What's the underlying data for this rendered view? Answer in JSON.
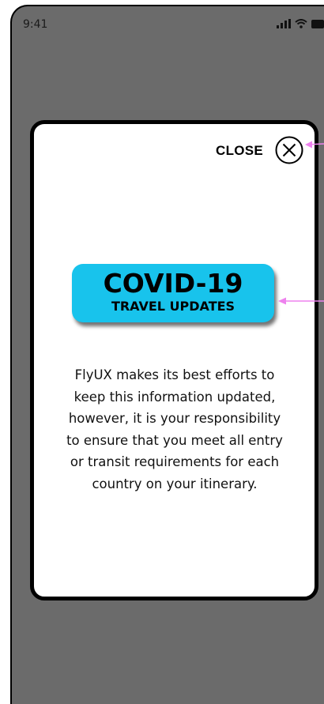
{
  "status_bar": {
    "time": "9:41",
    "signal_icon": "cellular-signal-icon",
    "wifi_icon": "wifi-icon",
    "battery_icon": "battery-icon"
  },
  "modal": {
    "close_label": "CLOSE",
    "close_icon": "close-circle-x-icon",
    "covid_button": {
      "title": "COVID-19",
      "subtitle": "TRAVEL UPDATES",
      "color": "#18c3ec"
    },
    "disclaimer": "FlyUX makes its best efforts to\nkeep this information updated,\nhowever, it is your responsibility\nto ensure that you meet all entry\nor transit requirements for each\ncountry on your itinerary."
  },
  "annotations": {
    "arrow_color": "#ee82ee"
  },
  "colors": {
    "backdrop": "#6b6b6b",
    "modal_background": "#ffffff",
    "modal_border": "#000000"
  }
}
